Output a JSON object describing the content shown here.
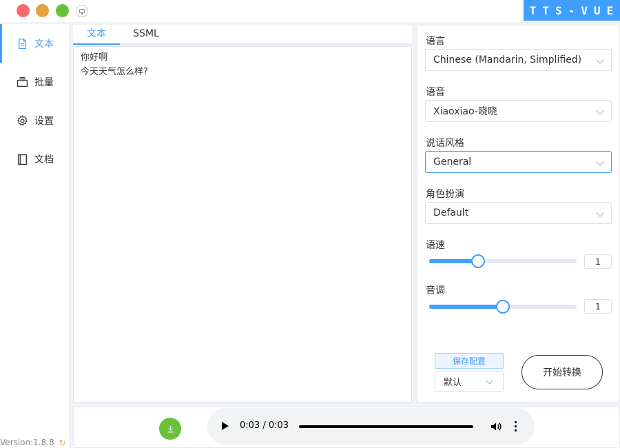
{
  "window": {
    "brand": "TTS-VUE",
    "colors": {
      "accent": "#409eff",
      "close": "#f56c6c",
      "minimize": "#e6a23c",
      "maximize": "#67c23a"
    }
  },
  "sidebar": {
    "items": [
      {
        "label": "文本",
        "icon": "document-icon",
        "active": true
      },
      {
        "label": "批量",
        "icon": "stack-icon",
        "active": false
      },
      {
        "label": "设置",
        "icon": "gear-icon",
        "active": false
      },
      {
        "label": "文档",
        "icon": "book-icon",
        "active": false
      }
    ],
    "version": "Version:1.8.8"
  },
  "editor": {
    "tabs": [
      "文本",
      "SSML"
    ],
    "active_tab": "文本",
    "content": "你好啊\n今天天气怎么样?"
  },
  "settings": {
    "language": {
      "label": "语言",
      "value": "Chinese (Mandarin, Simplified)"
    },
    "voice": {
      "label": "语音",
      "value": "Xiaoxiao-晓晓"
    },
    "style": {
      "label": "说话风格",
      "value": "General"
    },
    "role": {
      "label": "角色扮演",
      "value": "Default"
    },
    "rate": {
      "label": "语速",
      "value": "1",
      "fraction": 0.33
    },
    "pitch": {
      "label": "音调",
      "value": "1",
      "fraction": 0.5
    },
    "save_label": "保存配置",
    "profile": "默认",
    "start_label": "开始转换"
  },
  "player": {
    "time": "0:03 / 0:03",
    "progress": 1.0
  }
}
